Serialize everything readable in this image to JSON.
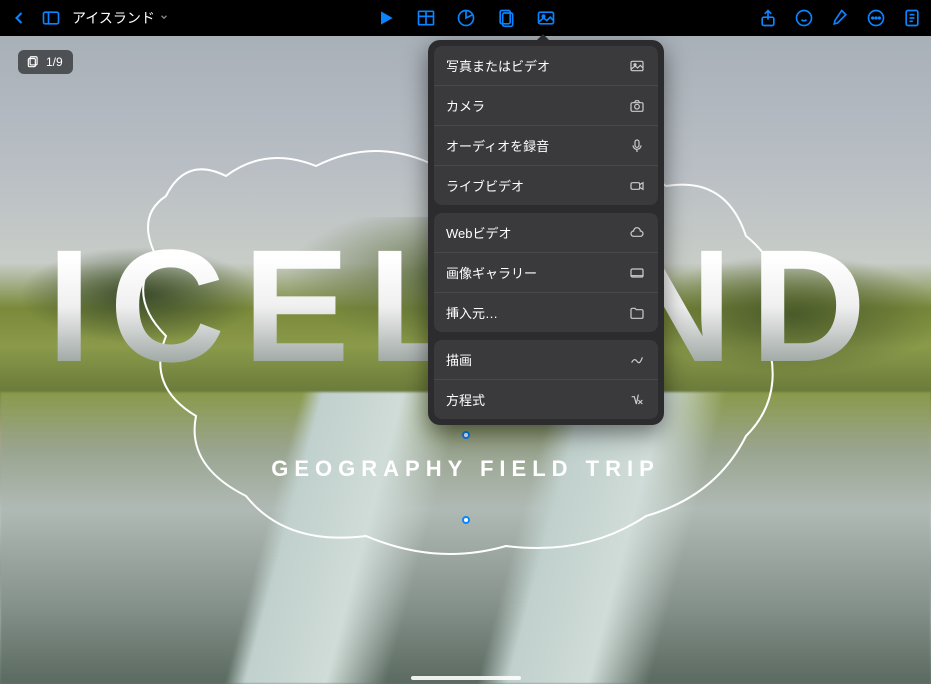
{
  "header": {
    "doc_title": "アイスランド"
  },
  "page_counter": "1/9",
  "slide": {
    "title": "ICELAND",
    "subtitle": "GEOGRAPHY FIELD TRIP"
  },
  "insert_menu": {
    "groups": [
      {
        "items": [
          {
            "label": "写真またはビデオ",
            "icon": "photo"
          },
          {
            "label": "カメラ",
            "icon": "camera"
          },
          {
            "label": "オーディオを録音",
            "icon": "mic"
          },
          {
            "label": "ライブビデオ",
            "icon": "video"
          }
        ]
      },
      {
        "items": [
          {
            "label": "Webビデオ",
            "icon": "cloud"
          },
          {
            "label": "画像ギャラリー",
            "icon": "gallery"
          },
          {
            "label": "挿入元…",
            "icon": "folder"
          }
        ]
      },
      {
        "items": [
          {
            "label": "描画",
            "icon": "scribble"
          },
          {
            "label": "方程式",
            "icon": "equation"
          }
        ]
      }
    ]
  }
}
